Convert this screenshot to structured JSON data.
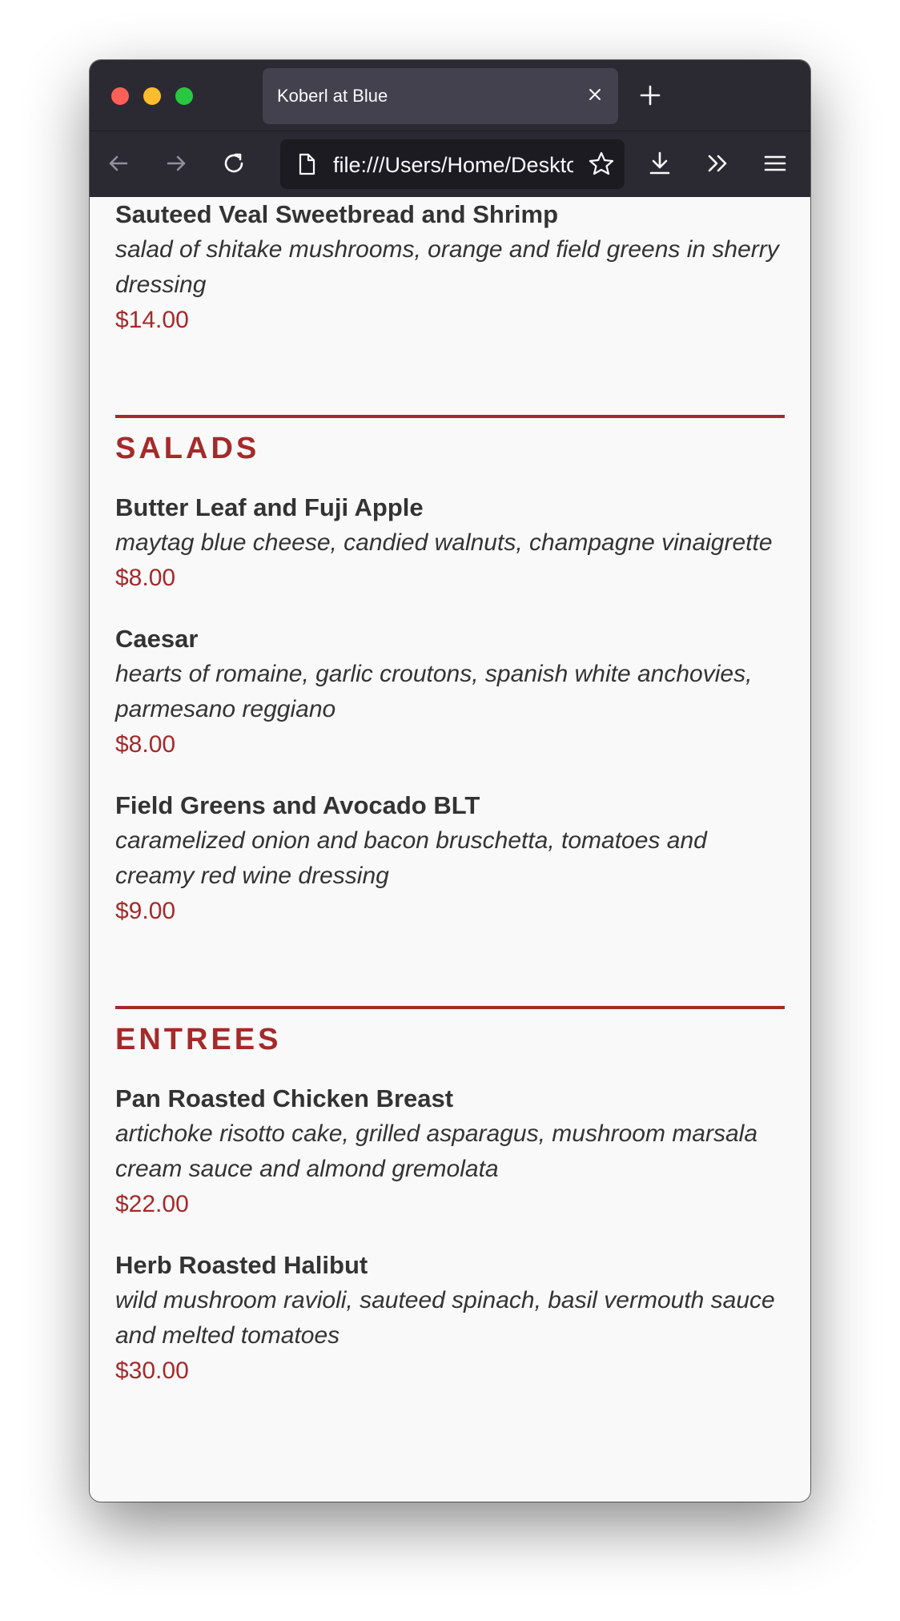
{
  "browser": {
    "tab_title": "Koberl at Blue",
    "url": "file:///Users/Home/Desktop/menu.html",
    "icons": [
      "close-icon",
      "plus-icon",
      "back-arrow-icon",
      "forward-arrow-icon",
      "reload-icon",
      "page-icon",
      "bookmark-star-icon",
      "download-icon",
      "overflow-chevrons-icon",
      "hamburger-menu-icon"
    ]
  },
  "menu": {
    "top_item": {
      "name": "Sauteed Veal Sweetbread and Shrimp",
      "description": "salad of shitake mushrooms, orange and field greens in sherry dressing",
      "price": "$14.00"
    },
    "salads": {
      "title": "SALADS",
      "items": [
        {
          "name": "Butter Leaf and Fuji Apple",
          "description": "maytag blue cheese, candied walnuts, champagne vinaigrette",
          "price": "$8.00"
        },
        {
          "name": "Caesar",
          "description": "hearts of romaine, garlic croutons, spanish white anchovies, parmesano reggiano",
          "price": "$8.00"
        },
        {
          "name": "Field Greens and Avocado BLT",
          "description": "caramelized onion and bacon bruschetta, tomatoes and creamy red wine dressing",
          "price": "$9.00"
        }
      ]
    },
    "entrees": {
      "title": "ENTREES",
      "items": [
        {
          "name": "Pan Roasted Chicken Breast",
          "description": "artichoke risotto cake, grilled asparagus, mushroom marsala cream sauce and almond gremolata",
          "price": "$22.00"
        },
        {
          "name": "Herb Roasted Halibut",
          "description": "wild mushroom ravioli, sauteed spinach, basil vermouth sauce and melted tomatoes",
          "price": "$30.00"
        }
      ]
    },
    "colors": {
      "accent": "#a52a2a",
      "text": "#333333",
      "page_background": "#f9f9fa",
      "chrome": "#2b2a33"
    }
  }
}
